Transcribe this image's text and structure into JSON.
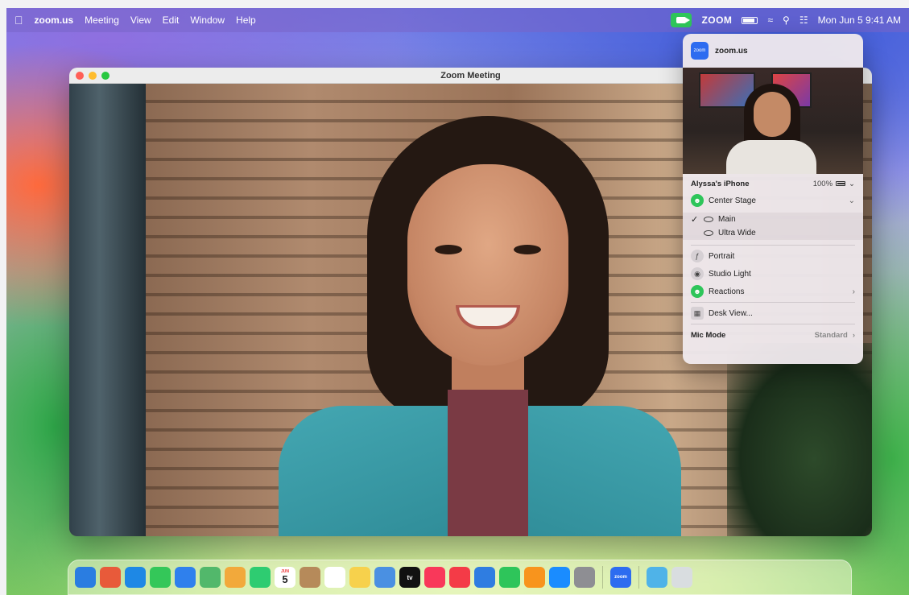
{
  "menubar": {
    "app": "zoom.us",
    "items": [
      "Meeting",
      "View",
      "Edit",
      "Window",
      "Help"
    ],
    "status_zoom": "ZOOM",
    "datetime": "Mon Jun 5  9:41 AM"
  },
  "window": {
    "title": "Zoom Meeting"
  },
  "panel": {
    "app_name": "zoom.us",
    "app_icon_text": "zoom",
    "device": "Alyssa's iPhone",
    "battery": "100%",
    "center_stage": "Center Stage",
    "lenses": [
      {
        "label": "Main",
        "checked": true
      },
      {
        "label": "Ultra Wide",
        "checked": false
      }
    ],
    "portrait": "Portrait",
    "studio_light": "Studio Light",
    "reactions": "Reactions",
    "desk_view": "Desk View...",
    "mic_mode": "Mic Mode",
    "mic_value": "Standard"
  },
  "dock": {
    "calendar_month": "JUN",
    "calendar_day": "5",
    "tv_label": "tv",
    "zoom_label": "zoom",
    "icons": [
      {
        "name": "finder",
        "color": "#2a7de1"
      },
      {
        "name": "launchpad",
        "color": "#e85a3a"
      },
      {
        "name": "safari",
        "color": "#1e88e5"
      },
      {
        "name": "messages",
        "color": "#34c759"
      },
      {
        "name": "mail",
        "color": "#2f80ed"
      },
      {
        "name": "maps",
        "color": "#52b86b"
      },
      {
        "name": "photos",
        "color": "#f2a93b"
      },
      {
        "name": "facetime",
        "color": "#2ecc71"
      },
      {
        "name": "calendar",
        "color": "#ffffff"
      },
      {
        "name": "contacts",
        "color": "#b68a5a"
      },
      {
        "name": "reminders",
        "color": "#ffffff"
      },
      {
        "name": "notes",
        "color": "#f7d14c"
      },
      {
        "name": "freeform",
        "color": "#4a90e2"
      },
      {
        "name": "tv",
        "color": "#111111"
      },
      {
        "name": "music",
        "color": "#f9385a"
      },
      {
        "name": "news",
        "color": "#f43b47"
      },
      {
        "name": "keynote",
        "color": "#2f7de1"
      },
      {
        "name": "numbers",
        "color": "#2ec55a"
      },
      {
        "name": "pages",
        "color": "#f8941d"
      },
      {
        "name": "app-store",
        "color": "#1a8cff"
      },
      {
        "name": "system-settings",
        "color": "#8e8e93"
      },
      {
        "name": "zoom",
        "color": "#2d6cf0"
      },
      {
        "name": "downloads-folder",
        "color": "#4fb3e8"
      },
      {
        "name": "trash",
        "color": "#d9dde0"
      }
    ]
  }
}
